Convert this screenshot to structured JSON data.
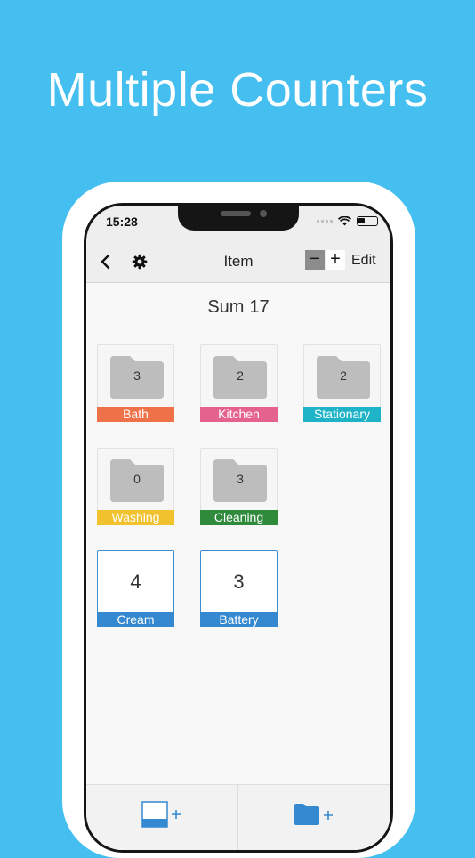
{
  "headline": "Multiple Counters",
  "status_bar": {
    "time": "15:28"
  },
  "nav": {
    "title": "Item",
    "minus": "−",
    "plus": "+",
    "edit": "Edit"
  },
  "summary": {
    "label": "Sum",
    "value": "17"
  },
  "tiles": [
    {
      "type": "folder",
      "count": "3",
      "label": "Bath",
      "color": "#ef7147"
    },
    {
      "type": "folder",
      "count": "2",
      "label": "Kitchen",
      "color": "#e6628e"
    },
    {
      "type": "folder",
      "count": "2",
      "label": "Stationary",
      "color": "#1fb3c8"
    },
    {
      "type": "folder",
      "count": "0",
      "label": "Washing",
      "color": "#f2c12e"
    },
    {
      "type": "folder",
      "count": "3",
      "label": "Cleaning",
      "color": "#2f8a3c"
    },
    {
      "type": "counter",
      "count": "4",
      "label": "Cream",
      "color": "#3489d0"
    },
    {
      "type": "counter",
      "count": "3",
      "label": "Battery",
      "color": "#3489d0"
    }
  ],
  "colors": {
    "background": "#45bff0",
    "accent": "#3489d0",
    "folder": "#bdbdbd"
  },
  "icons": {
    "back": "chevron-left-icon",
    "settings": "gear-icon",
    "add_counter": "add-counter-icon",
    "add_folder": "add-folder-icon"
  }
}
